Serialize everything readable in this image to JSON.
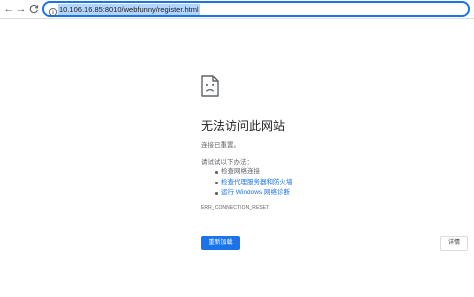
{
  "toolbar": {
    "back_glyph": "←",
    "forward_glyph": "→",
    "reload_glyph": "C",
    "url": "10.106.16.85:8010/webfunny/register.html",
    "site_info_icon": "info-icon"
  },
  "error": {
    "icon": "sad-page-icon",
    "title": "无法访问此网站",
    "subtitle": "连接已重置。",
    "try_label": "请试试以下办法：",
    "suggestions": [
      "检查网络连接",
      "检查代理服务器和防火墙",
      "运行 Windows 网络诊断"
    ],
    "code": "ERR_CONNECTION_RESET"
  },
  "buttons": {
    "reload": "重新加载",
    "details": "详情"
  },
  "colors": {
    "accent": "#1a73e8",
    "text": "#202124",
    "secondary_text": "#5f6368",
    "url_highlight": "#b3d4fc"
  }
}
